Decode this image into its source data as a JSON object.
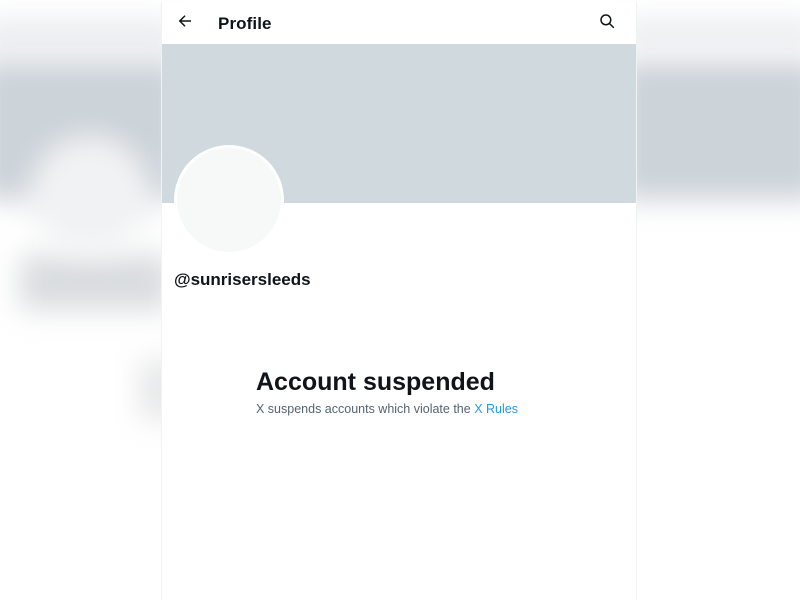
{
  "header": {
    "title": "Profile",
    "back_icon": "arrow-left-icon",
    "search_icon": "search-icon"
  },
  "profile": {
    "handle": "@sunrisersleeds"
  },
  "suspension": {
    "title": "Account suspended",
    "message_prefix": "X suspends accounts which violate the",
    "link_text": "X Rules"
  },
  "colors": {
    "banner": "#cfd9de",
    "avatar": "#f7f9f9",
    "link": "#1d9bf0",
    "text_primary": "#0f1419",
    "text_secondary": "#536471"
  }
}
